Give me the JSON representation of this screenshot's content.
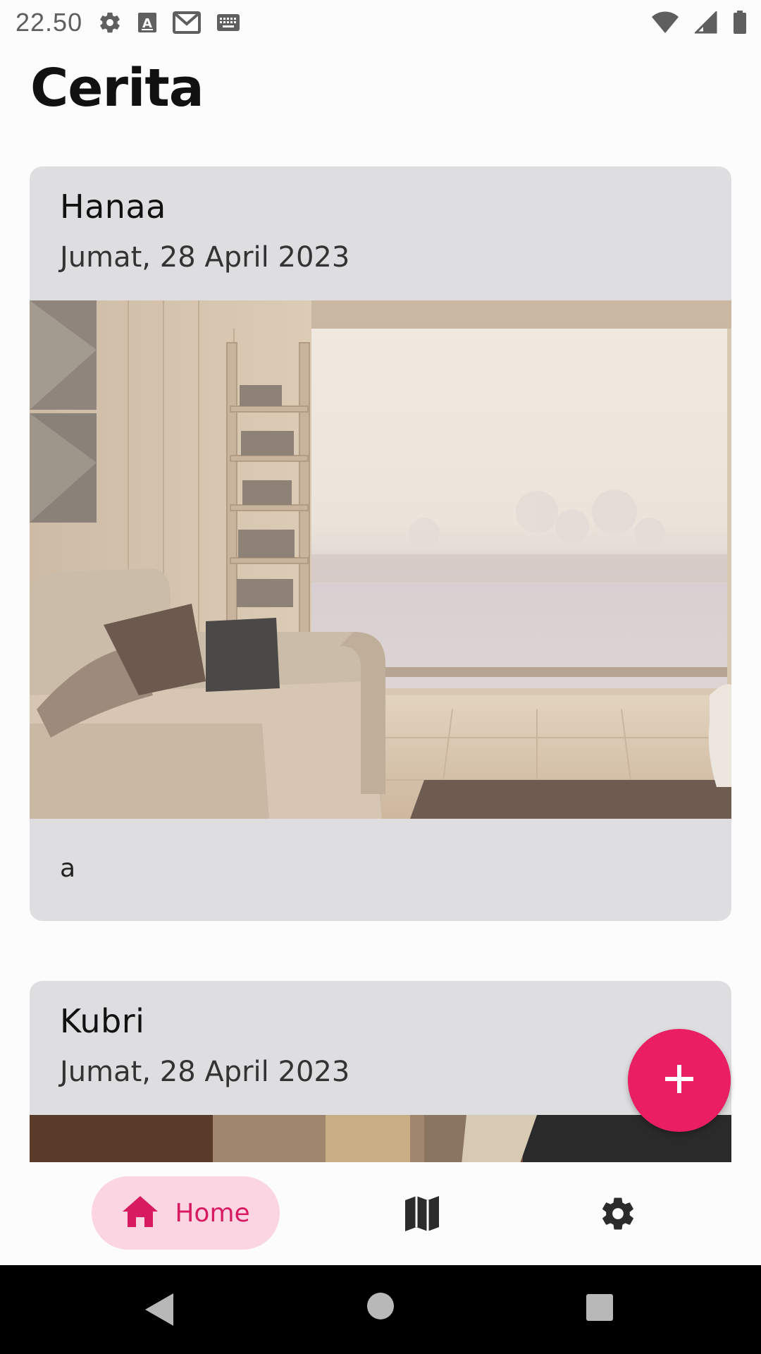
{
  "status_bar": {
    "time": "22.50",
    "icons": [
      "gear-icon",
      "text-a-icon",
      "gmail-icon",
      "keyboard-icon",
      "wifi-icon",
      "signal-icon",
      "battery-icon"
    ]
  },
  "page": {
    "title": "Cerita"
  },
  "stories": [
    {
      "name": "Hanaa",
      "date": "Jumat, 28 April 2023",
      "image": "living-room-photo",
      "description": "a"
    },
    {
      "name": "Kubri",
      "date": "Jumat, 28 April 2023",
      "image": "story-photo"
    }
  ],
  "fab": {
    "icon": "plus-icon"
  },
  "bottom_nav": {
    "items": [
      {
        "label": "Home",
        "icon": "home-icon",
        "selected": true
      },
      {
        "icon": "map-icon"
      },
      {
        "icon": "settings-icon"
      }
    ]
  },
  "colors": {
    "accent": "#e91e63",
    "nav_selected_bg": "#fbd6e2",
    "card_bg": "#dedddf"
  }
}
